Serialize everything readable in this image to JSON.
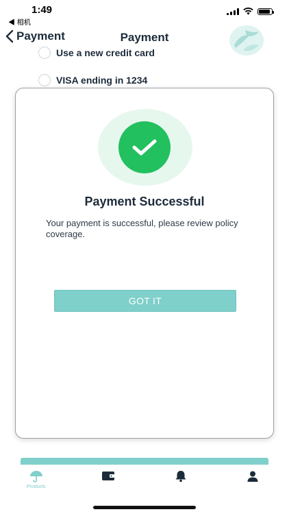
{
  "status_bar": {
    "time": "1:49",
    "back_app": "◀ 相机",
    "battery_level": 0.9
  },
  "header": {
    "back_label": "Payment",
    "title": "Payment"
  },
  "payment_options": [
    {
      "label": "Use a new credit card"
    },
    {
      "label": "VISA ending in 1234"
    }
  ],
  "modal": {
    "title": "Payment Successful",
    "message": "Your payment is successful, please review policy coverage.",
    "button_label": "GOT IT"
  },
  "tabbar": {
    "items": [
      {
        "name": "products",
        "label": "Products",
        "icon": "umbrella-icon",
        "active": true
      },
      {
        "name": "wallet",
        "label": "",
        "icon": "wallet-icon",
        "active": false
      },
      {
        "name": "notifications",
        "label": "",
        "icon": "bell-icon",
        "active": false
      },
      {
        "name": "profile",
        "label": "",
        "icon": "user-icon",
        "active": false
      }
    ]
  },
  "colors": {
    "accent": "#7fcfca",
    "success": "#22c05f",
    "text_dark": "#1c2b3a"
  }
}
